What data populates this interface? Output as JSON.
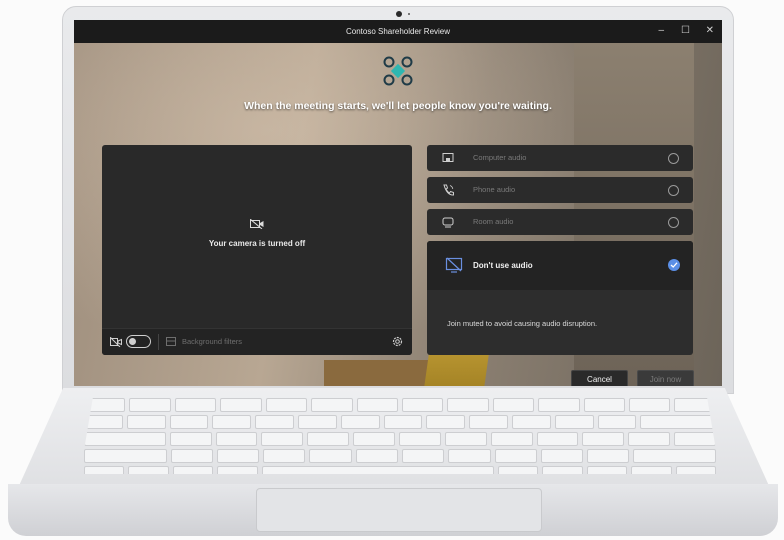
{
  "window": {
    "title": "Contoso Shareholder Review",
    "controls": [
      "minimize-icon",
      "maximize-icon",
      "close-icon"
    ]
  },
  "prejoin": {
    "logo_icon": "meeting-logo-icon",
    "waiting_message": "When the meeting starts, we'll let people know you're waiting."
  },
  "video": {
    "camera_off_icon": "camera-off-icon",
    "camera_off_text": "Your camera is turned off",
    "camera_toggle_on": false,
    "background_filters_label": "Background filters",
    "settings_icon": "gear-icon"
  },
  "audio": {
    "options": [
      {
        "label": "Computer audio",
        "icon": "computer-icon",
        "selected": false
      },
      {
        "label": "Phone audio",
        "icon": "phone-icon",
        "selected": false
      },
      {
        "label": "Room audio",
        "icon": "room-device-icon",
        "selected": false
      }
    ],
    "selected_option": {
      "label": "Don't use audio",
      "icon": "no-audio-icon",
      "selected": true,
      "description": "Join muted to avoid causing audio disruption."
    }
  },
  "actions": {
    "cancel_label": "Cancel",
    "join_label": "Join now"
  },
  "colors": {
    "accent": "#5b8fe6",
    "titlebar": "#1b1b1b",
    "panel": "#2b2b2b"
  }
}
